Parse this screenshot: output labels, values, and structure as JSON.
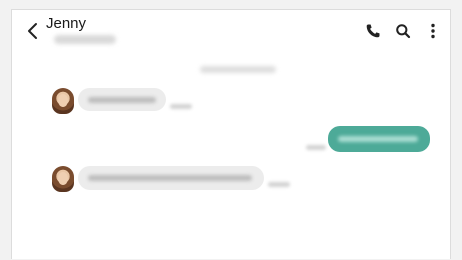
{
  "header": {
    "contact_name": "Jenny",
    "back_icon": "chevron-left-icon",
    "call_icon": "phone-icon",
    "search_icon": "search-icon",
    "more_icon": "more-vert-icon"
  },
  "colors": {
    "incoming_bubble": "#ececec",
    "outgoing_bubble": "#4daa98",
    "background": "#ffffff"
  },
  "messages": [
    {
      "direction": "incoming",
      "sender": "Jenny"
    },
    {
      "direction": "outgoing"
    },
    {
      "direction": "incoming",
      "sender": "Jenny"
    }
  ]
}
